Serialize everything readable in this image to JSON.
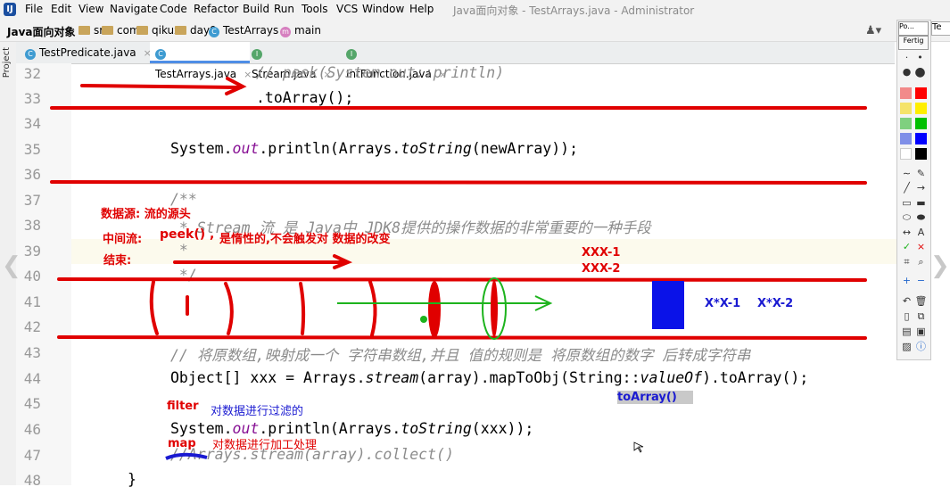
{
  "menu": {
    "items": [
      "File",
      "Edit",
      "View",
      "Navigate",
      "Code",
      "Refactor",
      "Build",
      "Run",
      "Tools",
      "VCS",
      "Window",
      "Help"
    ],
    "window_title": "Java面向对象 - TestArrays.java - Administrator"
  },
  "breadcrumb": {
    "project": "Java面向对象",
    "items": [
      "src",
      "com",
      "qikux",
      "day9",
      "TestArrays",
      "main"
    ]
  },
  "tabs": [
    "TestPredicate.java",
    "TestArrays.java",
    "Stream.java",
    "IntFunction.java"
  ],
  "sidebar": {
    "label": "Project"
  },
  "palette": {
    "top": "Po...",
    "button": "Fertig",
    "top_right": "Te"
  },
  "editor": {
    "lines": [
      {
        "n": "32",
        "code": "//.peek(System.out::println)"
      },
      {
        "n": "33",
        "code": ".toArray();"
      },
      {
        "n": "34",
        "code": ""
      },
      {
        "n": "35",
        "code": "System.out.println(Arrays.toString(newArray));"
      },
      {
        "n": "36",
        "code": ""
      },
      {
        "n": "37",
        "code": "/**"
      },
      {
        "n": "38",
        "code": " * Stream 流 是 Java中 JDK8提供的操作数据的非常重要的一种手段"
      },
      {
        "n": "39",
        "code": " *"
      },
      {
        "n": "40",
        "code": " */"
      },
      {
        "n": "41",
        "code": ""
      },
      {
        "n": "42",
        "code": ""
      },
      {
        "n": "43",
        "code": "// 将原数组,映射成一个 字符串数组,并且 值的规则是 将原数组的数字 后转成字符串"
      },
      {
        "n": "44",
        "code": "Object[] xxx = Arrays.stream(array).mapToObj(String::valueOf).toArray();"
      },
      {
        "n": "45",
        "code": ""
      },
      {
        "n": "46",
        "code": "System.out.println(Arrays.toString(xxx));"
      },
      {
        "n": "47",
        "code": "//Arrays.stream(array).collect()"
      },
      {
        "n": "48",
        "code": "}"
      }
    ]
  },
  "annotations": {
    "source": "数据源: 流的源头",
    "middle_label": "中间流:",
    "peek": "peek() ,",
    "peek_desc": "是惰性的,不会触发对 数据的改变",
    "end": "结束:",
    "xxx1": "XXX-1",
    "xxx2": "XXX-2",
    "x1": "X*X-1",
    "x2": "X*X-2",
    "toarray": "toArray()",
    "filter": "filter",
    "filter_desc": "对数据进行过滤的",
    "map": "map",
    "map_desc": "对数据进行加工处理"
  },
  "colors": {
    "ink_red": "#e00000",
    "ink_blue": "#1a1ad1",
    "ink_green": "#1db31d",
    "accent": "#4e8ee6"
  }
}
